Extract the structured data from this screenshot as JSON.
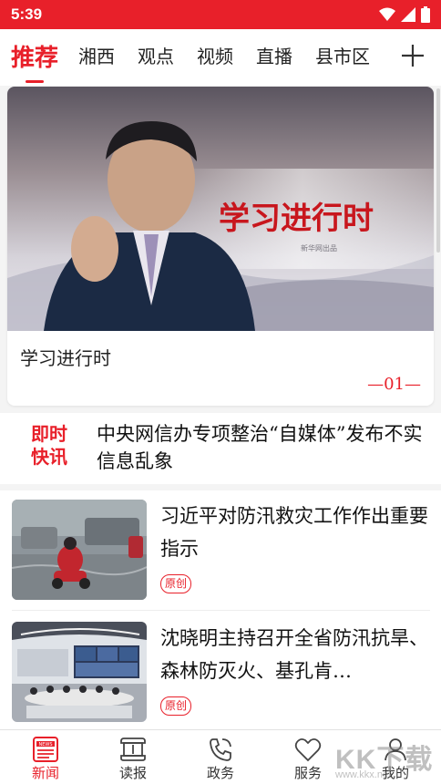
{
  "status_bar": {
    "time": "5:39",
    "icons": [
      "wifi-icon",
      "signal-icon",
      "battery-icon"
    ],
    "color": "#e8202a"
  },
  "channels": {
    "tabs": [
      "推荐",
      "湘西",
      "观点",
      "视频",
      "直播",
      "县市区"
    ],
    "active": "推荐",
    "add_icon": "plus-icon"
  },
  "hero": {
    "title": "学习进行时",
    "image_caption": "学习进行时",
    "image_sub": "新华网出品",
    "page_indicator": "—01—"
  },
  "flash": {
    "label_line1": "即时",
    "label_line2": "快讯",
    "text": "中央网信办专项整治“自媒体”发布不实信息乱象"
  },
  "news": [
    {
      "title": "习近平对防汛救灾工作作出重要指示",
      "tag": "原创"
    },
    {
      "title": "沈晓明主持召开全省防汛抗旱、森林防灭火、基孔肯…",
      "tag": "原创"
    }
  ],
  "bottom_nav": {
    "items": [
      {
        "label": "新闻",
        "icon": "news-icon",
        "active": true
      },
      {
        "label": "读报",
        "icon": "newspaper-icon",
        "active": false
      },
      {
        "label": "政务",
        "icon": "phone-icon",
        "active": false
      },
      {
        "label": "服务",
        "icon": "heart-icon",
        "active": false
      },
      {
        "label": "我的",
        "icon": "user-icon",
        "active": false
      }
    ]
  },
  "watermark": {
    "text": "KK下载",
    "url": "www.kkx.net"
  },
  "colors": {
    "accent": "#e8202a",
    "text": "#111111",
    "background": "#f4f4f4"
  }
}
